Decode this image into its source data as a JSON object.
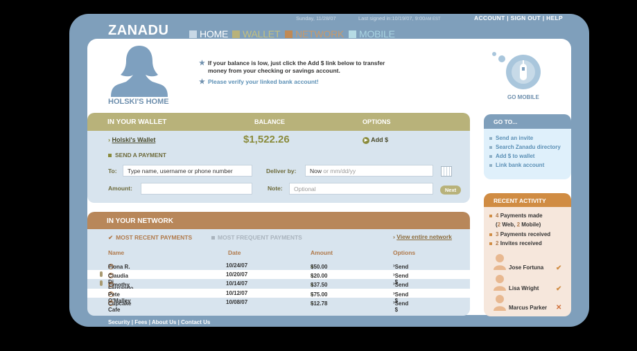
{
  "brand": {
    "logo": "ZANADU"
  },
  "top_bar": {
    "date": "Sunday, 11/28/07",
    "last_signed": "Last signed in:10/19/07, 9:00",
    "time_suffix": "AM EST",
    "links": [
      "ACCOUNT",
      "SIGN OUT",
      "HELP"
    ]
  },
  "nav": {
    "items": [
      {
        "label": "HOME",
        "color": "#ffffff",
        "sq": "#c8d8e6"
      },
      {
        "label": "WALLET",
        "color": "#c4c07e",
        "sq": "#b8b27a"
      },
      {
        "label": "NETWORK",
        "color": "#c89a6a",
        "sq": "#c08a55"
      },
      {
        "label": "MOBILE",
        "color": "#a9d4e2",
        "sq": "#b6dbe4"
      }
    ]
  },
  "profile": {
    "title": "HOLSKI'S HOME"
  },
  "messages": {
    "line1": "If your balance is low, just click the Add $ link below to transfer",
    "line2": "money from your checking or savings account.",
    "verify": "Please verify your linked bank account!"
  },
  "mobile": {
    "label": "GO MOBILE"
  },
  "wallet": {
    "header": "IN YOUR WALLET",
    "balance_header": "BALANCE",
    "options_header": "OPTIONS",
    "account_link": "Holski's Wallet",
    "balance": "$1,522.26",
    "add_link": "Add $",
    "send_payment": "SEND A PAYMENT",
    "to_label": "To:",
    "to_placeholder": "Type name, username or phone number",
    "deliver_label": "Deliver by:",
    "deliver_value": "Now",
    "deliver_hint": "or mm/dd/yy",
    "amount_label": "Amount:",
    "note_label": "Note:",
    "note_placeholder": "Optional",
    "next": "Next"
  },
  "network": {
    "header": "IN YOUR NETWORK",
    "tab_recent": "MOST RECENT PAYMENTS",
    "tab_frequent": "MOST FREQUENT PAYMENTS",
    "view_link": "View entire network",
    "columns": [
      "Name",
      "Date",
      "Amount",
      "Options"
    ],
    "rows": [
      {
        "name": "Fiona R. Fitzgerald",
        "date": "10/24/07",
        "sign": "+",
        "amount": "$50.00",
        "option": "Send $",
        "pin": false
      },
      {
        "name": "Claudia Di Fernando",
        "date": "10/20/07",
        "sign": "−",
        "amount": "$20.00",
        "option": "Send $",
        "pin": true
      },
      {
        "name": "Timothy Greenberg",
        "date": "10/14/07",
        "sign": "+",
        "amount": "$37.50",
        "option": "Send $",
        "pin": true
      },
      {
        "name": "Pete O'Malley",
        "date": "10/12/07",
        "sign": "−",
        "amount": "$75.00",
        "option": "Send $",
        "pin": false
      },
      {
        "name": "Cupcake Cafe",
        "date": "10/08/07",
        "sign": "−",
        "amount": "$12.78",
        "option": "Send $",
        "pin": false
      }
    ]
  },
  "goto": {
    "header": "GO TO...",
    "items": [
      "Send an invite",
      "Search Zanadu directory",
      "Add $ to wallet",
      "Link bank account"
    ]
  },
  "recent_activity": {
    "header": "RECENT ACTIVITY",
    "payments_made_count": "4",
    "payments_made_text": "Payments made",
    "breakdown_open": "(",
    "breakdown_web_count": "2",
    "breakdown_web": "Web,",
    "breakdown_mobile_count": "2",
    "breakdown_mobile": "Mobile)",
    "payments_received_count": "3",
    "payments_received_text": "Payments received",
    "invites_count": "2",
    "invites_text": "Invites received",
    "people": [
      {
        "name": "Jose Fortuna",
        "mark": "✔"
      },
      {
        "name": "Lisa Wright",
        "mark": "✔"
      },
      {
        "name": "Marcus Parker",
        "mark": "✕"
      }
    ]
  },
  "footer": {
    "links": [
      "Security",
      "Fees",
      "About Us",
      "Contact Us"
    ]
  }
}
